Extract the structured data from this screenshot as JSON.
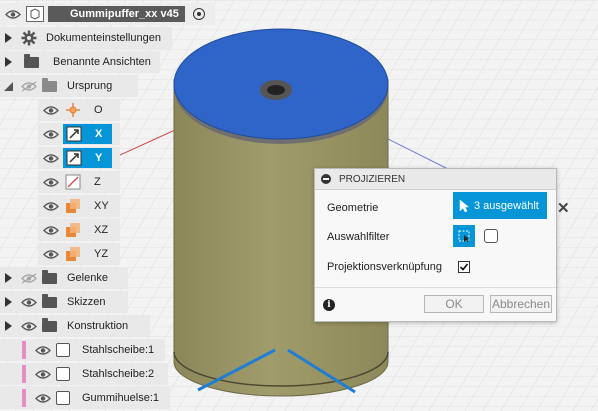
{
  "browser": {
    "root_label": "Gummipuffer_xx v45",
    "items": [
      {
        "label": "Dokumenteinstellungen"
      },
      {
        "label": "Benannte Ansichten"
      },
      {
        "label": "Ursprung"
      },
      {
        "label": "O"
      },
      {
        "label": "X"
      },
      {
        "label": "Y"
      },
      {
        "label": "Z"
      },
      {
        "label": "XY"
      },
      {
        "label": "XZ"
      },
      {
        "label": "YZ"
      },
      {
        "label": "Gelenke"
      },
      {
        "label": "Skizzen"
      },
      {
        "label": "Konstruktion"
      },
      {
        "label": "Stahlscheibe:1"
      },
      {
        "label": "Stahlscheibe:2"
      },
      {
        "label": "Gummihuelse:1"
      }
    ]
  },
  "dialog": {
    "title": "PROJIZIEREN",
    "geometry_label": "Geometrie",
    "geometry_value": "3 ausgewählt",
    "filter_label": "Auswahlfilter",
    "link_label": "Projektionsverknüpfung",
    "link_checked": true,
    "ok_label": "OK",
    "cancel_label": "Abbrechen"
  },
  "colors": {
    "accent": "#0696d7",
    "top_face": "#2f64c8",
    "cylinder": "#9a9566",
    "axis_red": "#d04a4a",
    "component_bar": "#e58fc5"
  },
  "icons": {
    "visibility": "eye-icon",
    "settings": "gear-icon",
    "folder": "folder-icon",
    "point": "origin-point-icon",
    "axis": "axis-icon",
    "plane": "plane-icon",
    "body": "body-icon",
    "collapse": "minus-circle-icon",
    "info": "info-icon",
    "close": "close-icon",
    "cursor": "cursor-icon"
  }
}
